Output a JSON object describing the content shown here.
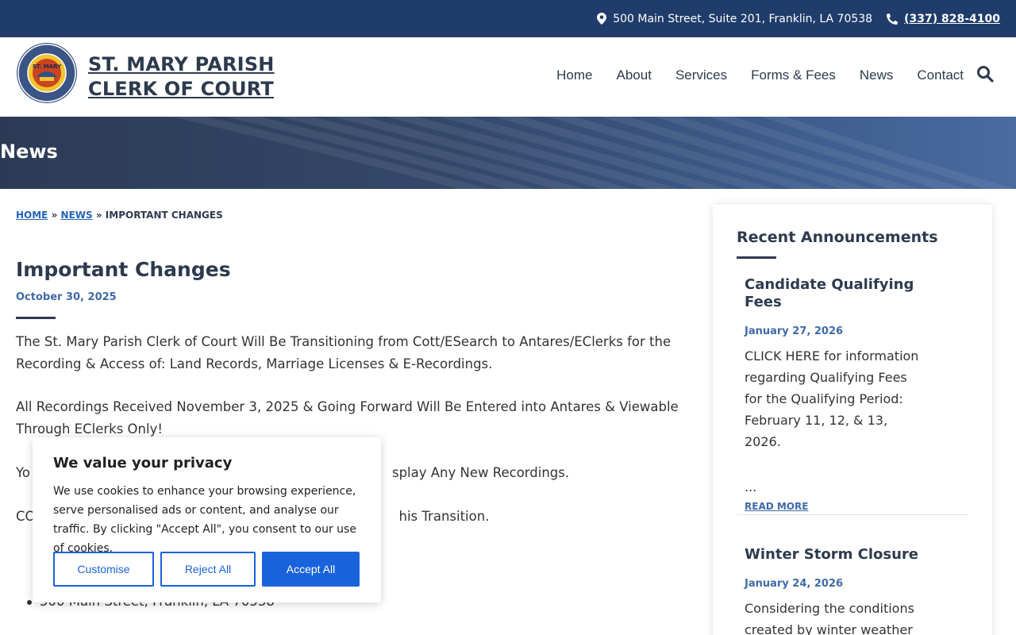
{
  "topbar": {
    "address": "500 Main Street, Suite 201, Franklin, LA 70538",
    "phone": "(337) 828-4100"
  },
  "header": {
    "title_line1": "ST. MARY PARISH",
    "title_line2": "CLERK OF COURT",
    "logo_text": "ST. MARY PARISH"
  },
  "nav": {
    "items": [
      "Home",
      "About",
      "Services",
      "Forms & Fees",
      "News",
      "Contact"
    ]
  },
  "hero": {
    "title": "News"
  },
  "breadcrumb": {
    "home": "HOME",
    "sep1": "»",
    "news": "NEWS",
    "sep2": "»",
    "current": "IMPORTANT CHANGES"
  },
  "post": {
    "title": "Important Changes",
    "date": "October 30, 2025",
    "p1": "The St. Mary Parish Clerk of Court Will Be Transitioning from Cott/ESearch to Antares/EClerks for the Recording & Access of: Land Records, Marriage Licenses & E-Recordings.",
    "p2": "All Recordings Received November 3, 2025 & Going Forward Will Be Entered into Antares & Viewable Through EClerks Only!",
    "p3_start": "Yo",
    "p3_end": "splay Any New Recordings.",
    "p4_start": "CO",
    "p4_end": "his Transition.",
    "bullet": "500 Main Street, Franklin, LA 70538"
  },
  "sidebar": {
    "heading": "Recent Announcements",
    "announcements": [
      {
        "title": "Candidate Qualifying Fees",
        "date": "January 27, 2026",
        "text": "CLICK HERE for information regarding Qualifying Fees for the Qualifying Period: February 11, 12, & 13, 2026.",
        "ellipsis": "...",
        "more": "READ MORE"
      },
      {
        "title": "Winter Storm Closure",
        "date": "January 24, 2026",
        "text": "Considering the conditions created by winter weather and"
      }
    ]
  },
  "cookie": {
    "title": "We value your privacy",
    "text": "We use cookies to enhance your browsing experience, serve personalised ads or content, and analyse our traffic. By clicking \"Accept All\", you consent to our use of cookies.",
    "customise": "Customise",
    "reject": "Reject All",
    "accept": "Accept All"
  },
  "colors": {
    "topbar": "#1f3c6b",
    "accent_blue": "#1863dc",
    "heading": "#2d3a4e",
    "date": "#3f6aa8"
  }
}
